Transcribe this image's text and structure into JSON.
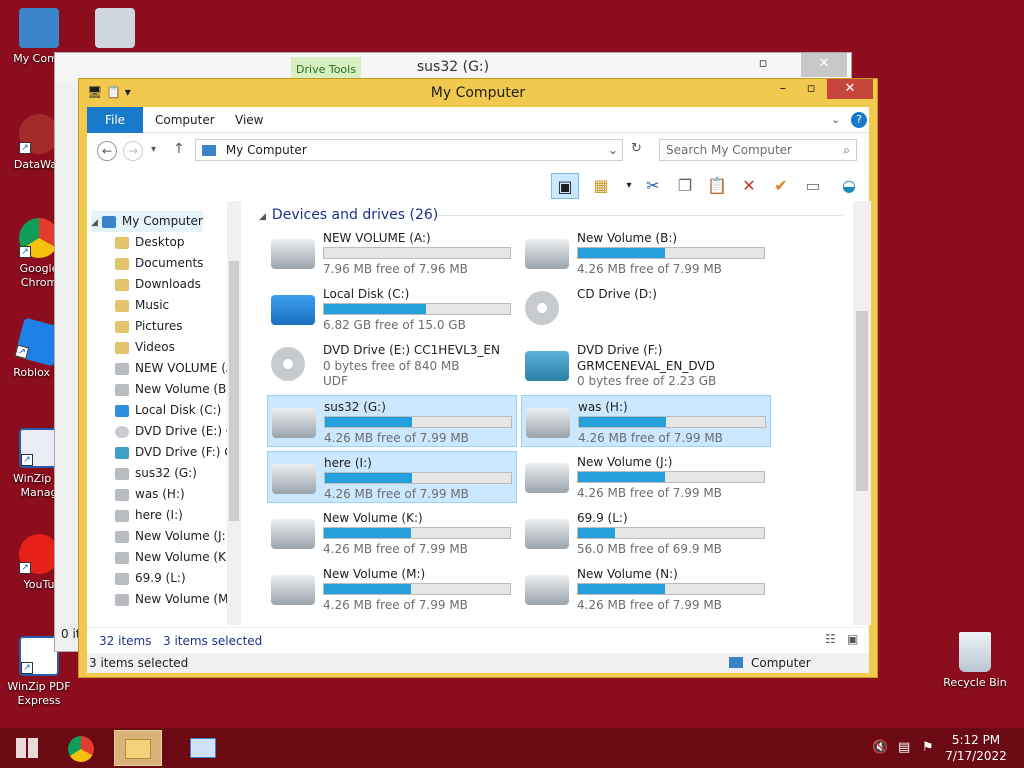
{
  "desktop": {
    "icons": [
      {
        "label": "My Comp",
        "icon": "computer-icon"
      },
      {
        "label": "DataWag",
        "icon": "datawag-icon"
      },
      {
        "label": "Google Chrom",
        "icon": "chrome-icon"
      },
      {
        "label": "Roblox St",
        "icon": "roblox-icon"
      },
      {
        "label": "WinZip In Manag",
        "icon": "winzip-icon"
      },
      {
        "label": "YouTu",
        "icon": "youtube-icon"
      },
      {
        "label": "WinZip PDF Express",
        "icon": "pdf-icon"
      },
      {
        "label": "Recycle Bin",
        "icon": "recycle-bin-icon"
      }
    ]
  },
  "back_window": {
    "title": "sus32 (G:)",
    "tools_tab": "Drive Tools",
    "status_fragment": "0 it"
  },
  "window": {
    "title": "My Computer",
    "accent": "#f2c94f",
    "ribbon_tabs": [
      "File",
      "Computer",
      "View"
    ],
    "address": "My Computer",
    "search_placeholder": "Search My Computer",
    "status_items": "32 items",
    "status_selected": "3 items selected",
    "bottom_status": "3 items selected",
    "bottom_location": "Computer"
  },
  "nav": {
    "items": [
      "My Computer",
      "Desktop",
      "Documents",
      "Downloads",
      "Music",
      "Pictures",
      "Videos",
      "NEW VOLUME (A",
      "New Volume (B:)",
      "Local Disk (C:)",
      "DVD Drive (E:) CC",
      "DVD Drive (F:) GR",
      "sus32 (G:)",
      "was (H:)",
      "here (I:)",
      "New Volume (J:)",
      "New Volume (K:)",
      "69.9 (L:)",
      "New Volume (M:"
    ]
  },
  "content": {
    "group_title": "Devices and drives (26)",
    "drives": [
      {
        "name": "NEW VOLUME (A:)",
        "free": "7.96 MB free of 7.96 MB",
        "fill": 0.0,
        "selected": false,
        "kind": "hdd"
      },
      {
        "name": "New Volume (B:)",
        "free": "4.26 MB free of 7.99 MB",
        "fill": 0.47,
        "selected": false,
        "kind": "hdd"
      },
      {
        "name": "Local Disk (C:)",
        "free": "6.82 GB free of 15.0 GB",
        "fill": 0.55,
        "selected": false,
        "kind": "windows"
      },
      {
        "name": "CD Drive (D:)",
        "free": "",
        "fill": null,
        "selected": false,
        "kind": "cd"
      },
      {
        "name": "DVD Drive (E:) CC1HEVL3_EN",
        "free": "0 bytes free of 840 MB",
        "extra": "UDF",
        "fill": null,
        "selected": false,
        "kind": "dvd"
      },
      {
        "name": "DVD Drive (F:)",
        "sub": "GRMCENEVAL_EN_DVD",
        "free": "0 bytes free of 2.23 GB",
        "fill": null,
        "selected": false,
        "kind": "dvd2"
      },
      {
        "name": "sus32 (G:)",
        "free": "4.26 MB free of 7.99 MB",
        "fill": 0.47,
        "selected": true,
        "kind": "hdd"
      },
      {
        "name": "was (H:)",
        "free": "4.26 MB free of 7.99 MB",
        "fill": 0.47,
        "selected": true,
        "kind": "hdd"
      },
      {
        "name": "here (I:)",
        "free": "4.26 MB free of 7.99 MB",
        "fill": 0.47,
        "selected": true,
        "kind": "hdd"
      },
      {
        "name": "New Volume (J:)",
        "free": "4.26 MB free of 7.99 MB",
        "fill": 0.47,
        "selected": false,
        "kind": "hdd"
      },
      {
        "name": "New Volume (K:)",
        "free": "4.26 MB free of 7.99 MB",
        "fill": 0.47,
        "selected": false,
        "kind": "hdd"
      },
      {
        "name": "69.9 (L:)",
        "free": "56.0 MB free of 69.9 MB",
        "fill": 0.2,
        "selected": false,
        "kind": "hdd"
      },
      {
        "name": "New Volume (M:)",
        "free": "4.26 MB free of 7.99 MB",
        "fill": 0.47,
        "selected": false,
        "kind": "hdd"
      },
      {
        "name": "New Volume (N:)",
        "free": "4.26 MB free of 7.99 MB",
        "fill": 0.47,
        "selected": false,
        "kind": "hdd"
      }
    ]
  },
  "taskbar": {
    "time": "5:12 PM",
    "date": "7/17/2022"
  }
}
